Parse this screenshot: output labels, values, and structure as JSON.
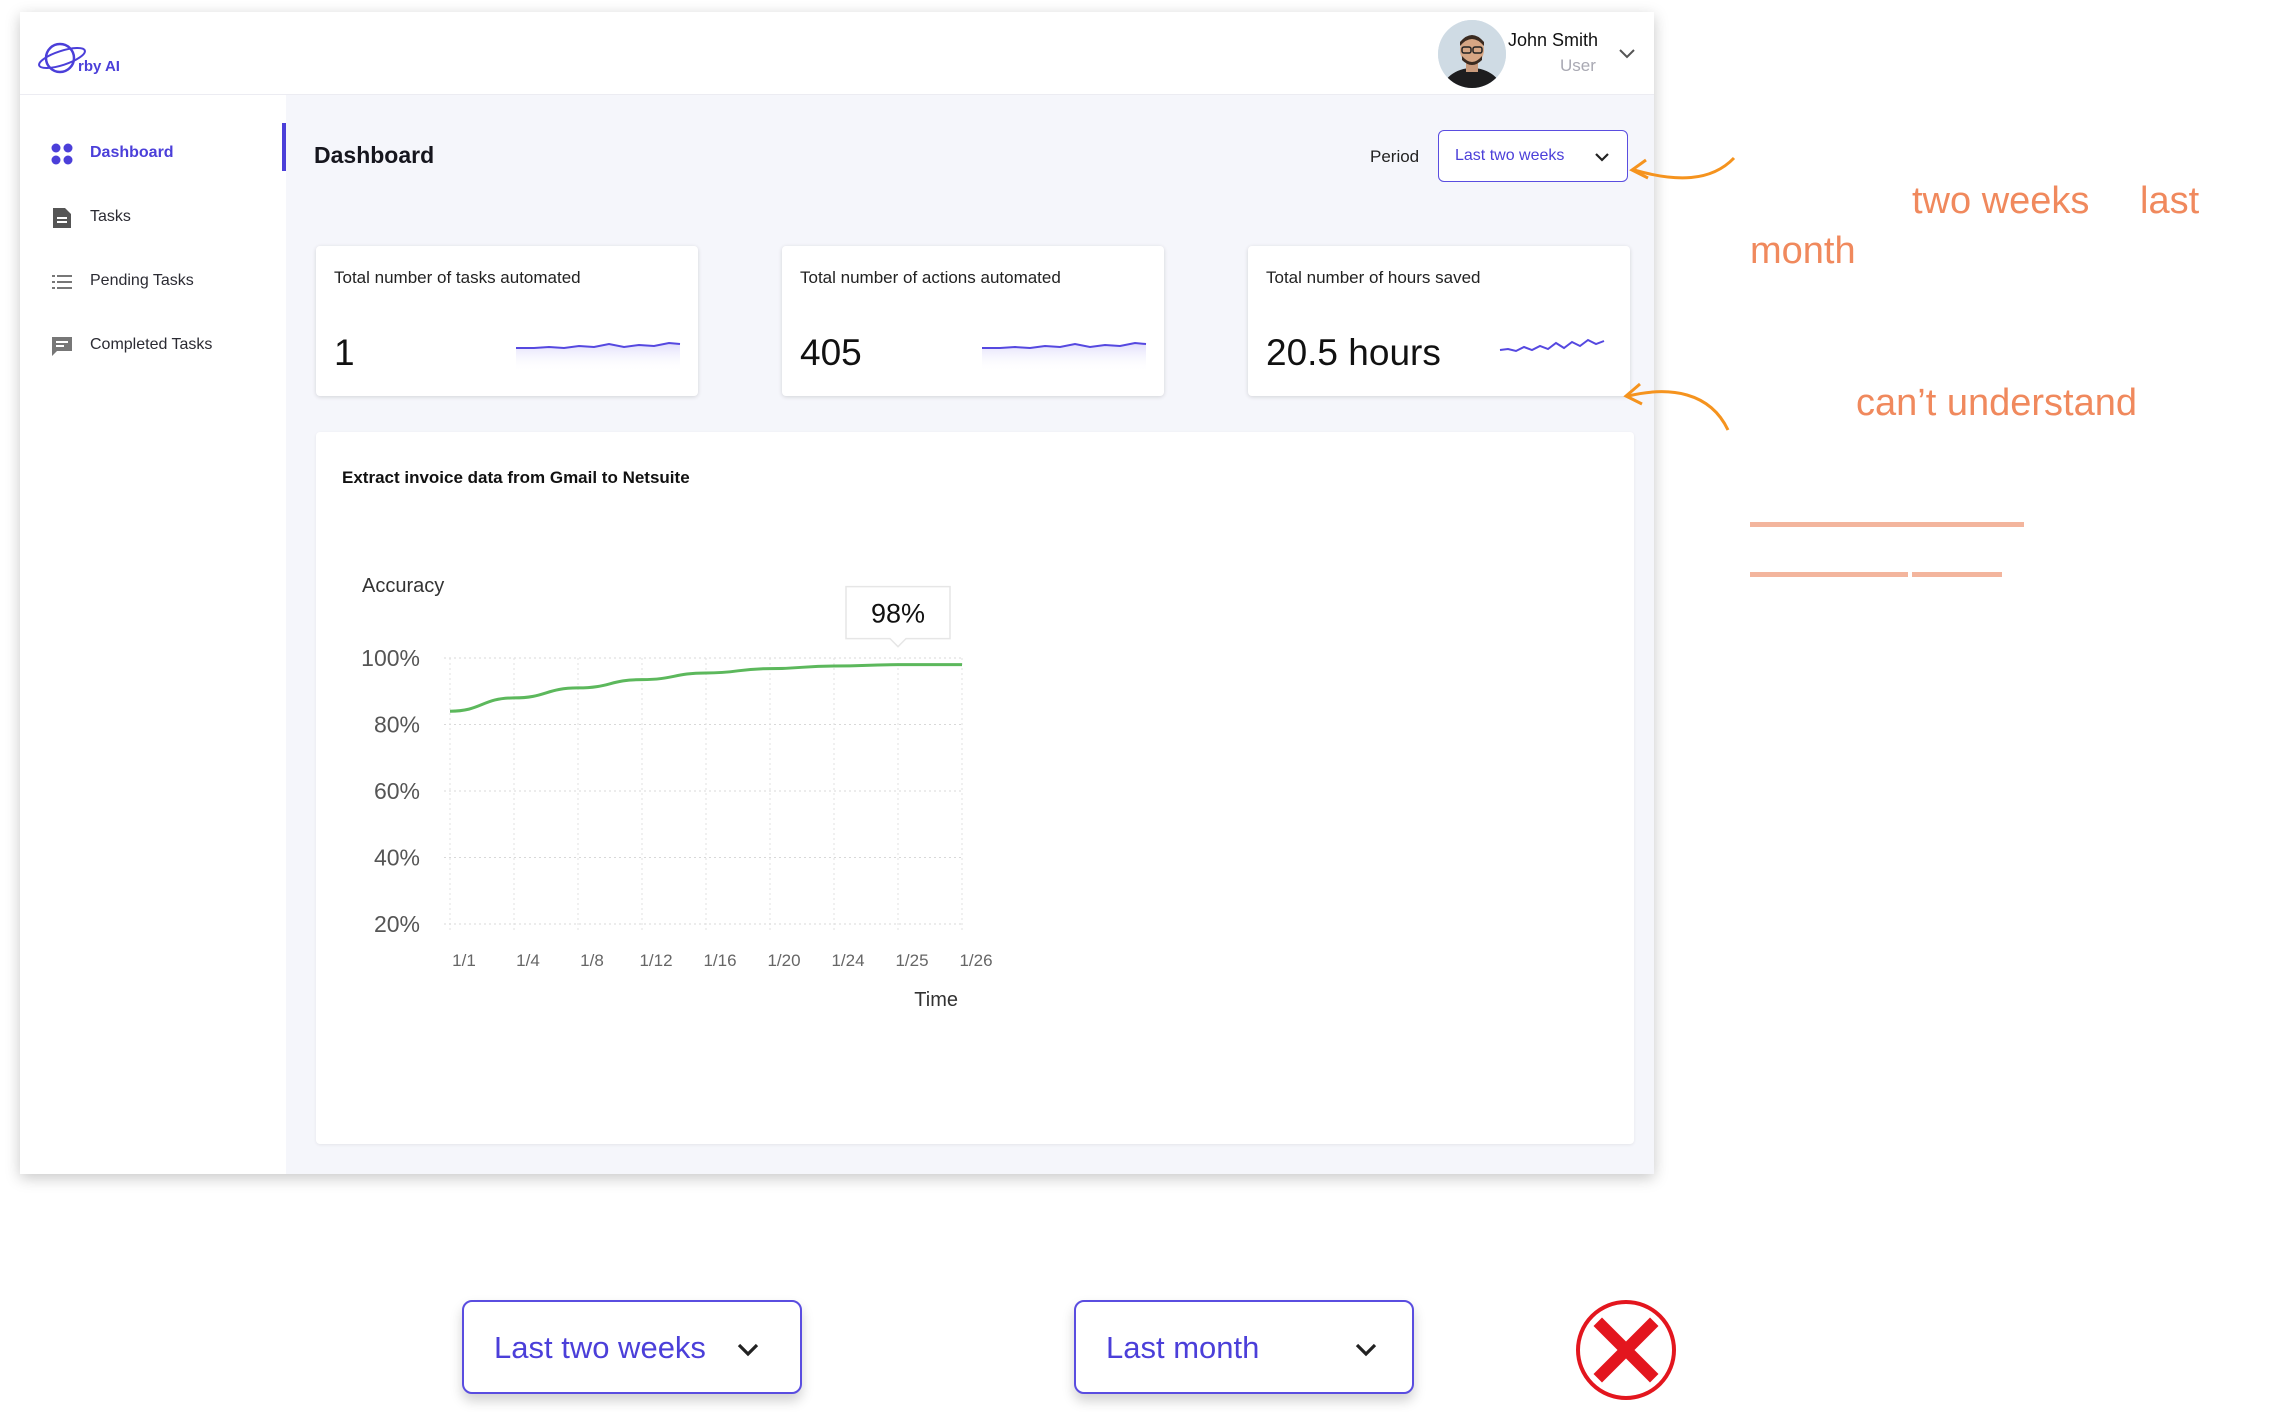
{
  "app": {
    "logo_text": "rby AI",
    "user": {
      "name": "John Smith",
      "role": "User"
    }
  },
  "sidebar": {
    "items": [
      {
        "label": "Dashboard",
        "icon": "grid-icon",
        "active": true
      },
      {
        "label": "Tasks",
        "icon": "document-icon",
        "active": false
      },
      {
        "label": "Pending Tasks",
        "icon": "list-icon",
        "active": false
      },
      {
        "label": "Completed Tasks",
        "icon": "message-icon",
        "active": false
      }
    ]
  },
  "header": {
    "title": "Dashboard",
    "period_label": "Period",
    "period_value": "Last two weeks"
  },
  "cards": [
    {
      "title": "Total number of tasks automated",
      "value": "1"
    },
    {
      "title": "Total number of actions automated",
      "value": "405"
    },
    {
      "title": "Total number of hours saved",
      "value": "20.5 hours"
    }
  ],
  "chart_section": {
    "title": "Extract invoice data from Gmail to Netsuite"
  },
  "chart_data": {
    "type": "line",
    "ylabel": "Accuracy",
    "xlabel": "Time",
    "categories": [
      "1/1",
      "1/4",
      "1/8",
      "1/12",
      "1/16",
      "1/20",
      "1/24",
      "1/25",
      "1/26"
    ],
    "y_ticks": [
      "100%",
      "80%",
      "60%",
      "40%",
      "20%"
    ],
    "ylim": [
      20,
      100
    ],
    "series": [
      {
        "values": [
          84,
          88,
          91,
          93.5,
          95.5,
          96.8,
          97.6,
          98,
          98
        ]
      }
    ],
    "tooltip": "98%",
    "grid": true,
    "color": "#5cb85c"
  },
  "annotations": {
    "note_line1": "two weeks",
    "note_line1b": "last",
    "note_line2": "month",
    "note_line3": "can’t understand",
    "color": "#f0895d",
    "arrow_color": "#f5931e"
  },
  "options": {
    "option1": "Last two weeks",
    "option2": "Last month"
  },
  "accent_color": "#4b3fd9",
  "reject_color": "#e3161e"
}
